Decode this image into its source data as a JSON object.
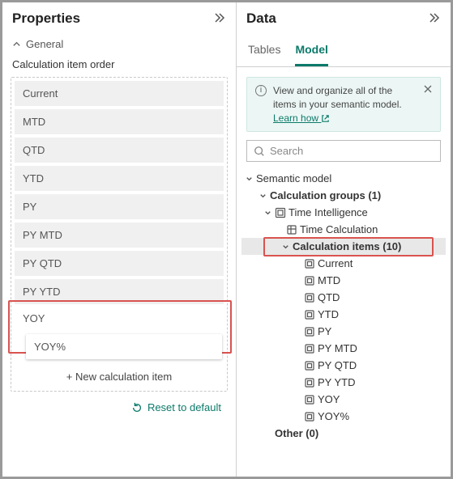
{
  "props": {
    "title": "Properties",
    "general_label": "General",
    "subhead": "Calculation item order",
    "items": [
      "Current",
      "MTD",
      "QTD",
      "YTD",
      "PY",
      "PY MTD",
      "PY QTD",
      "PY YTD",
      "YOY",
      "YOY%"
    ],
    "add_label": "+ New calculation item",
    "reset_label": "Reset to default"
  },
  "data": {
    "title": "Data",
    "tabs": {
      "tables": "Tables",
      "model": "Model"
    },
    "info": {
      "text": "View and organize all of the items in your semantic model. ",
      "link": "Learn how"
    },
    "search_placeholder": "Search",
    "tree": {
      "root": "Semantic model",
      "group": "Calculation groups (1)",
      "group_item": "Time Intelligence",
      "time_calc": "Time Calculation",
      "calc_items": "Calculation items (10)",
      "leaves": [
        "Current",
        "MTD",
        "QTD",
        "YTD",
        "PY",
        "PY MTD",
        "PY QTD",
        "PY YTD",
        "YOY",
        "YOY%"
      ],
      "other": "Other (0)"
    }
  },
  "colors": {
    "accent": "#0c7a6a",
    "highlight": "#d9534f"
  }
}
